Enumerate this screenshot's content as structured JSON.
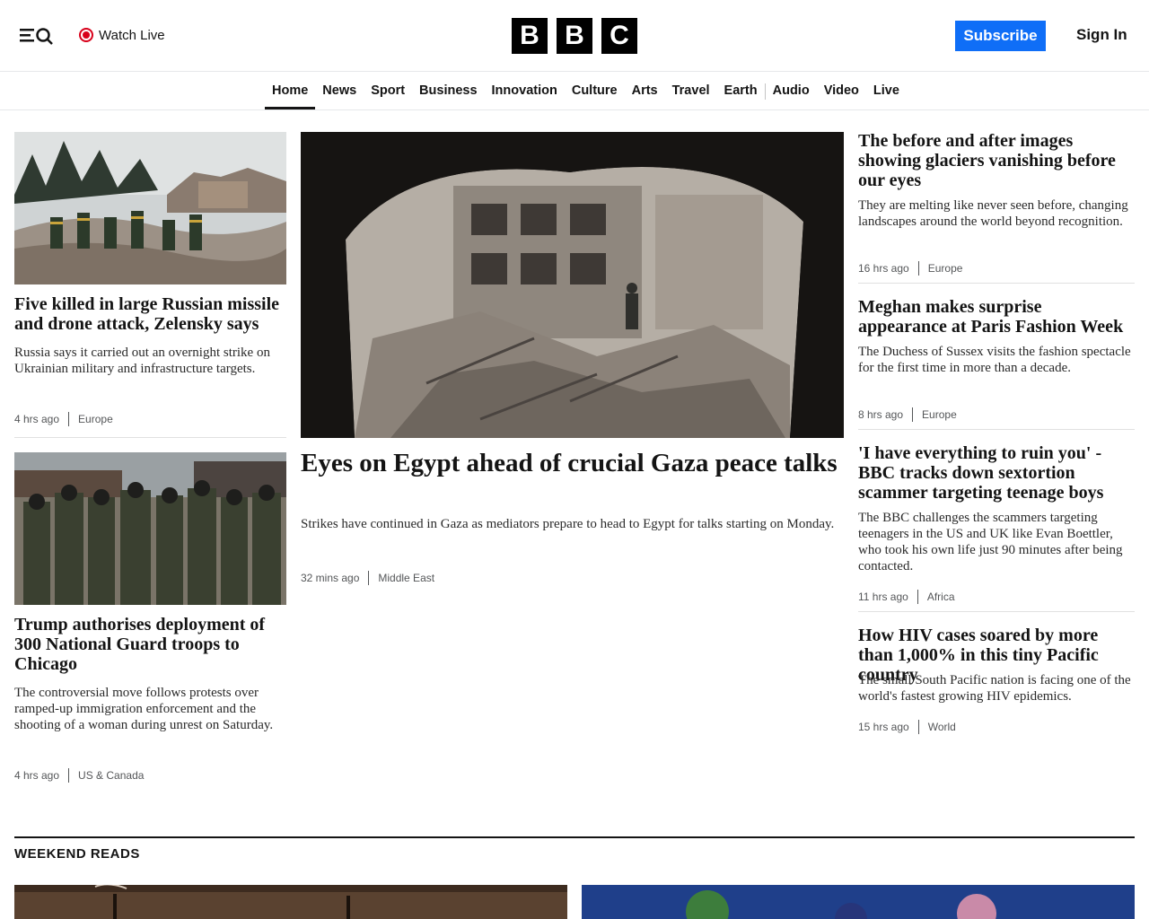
{
  "header": {
    "watch_live_label": "Watch Live",
    "logo_letters": [
      "B",
      "B",
      "C"
    ],
    "subscribe_label": "Subscribe",
    "signin_label": "Sign In"
  },
  "nav": {
    "items": [
      "Home",
      "News",
      "Sport",
      "Business",
      "Innovation",
      "Culture",
      "Arts",
      "Travel",
      "Earth",
      "Audio",
      "Video",
      "Live"
    ],
    "active": "Home"
  },
  "articles": {
    "left1": {
      "headline": "Five killed in large Russian missile and drone attack, Zelensky says",
      "summary": "Russia says it carried out an overnight strike on Ukrainian military and infrastructure targets.",
      "time": "4 hrs ago",
      "category": "Europe"
    },
    "left2": {
      "headline": "Trump authorises deployment of 300 National Guard troops to Chicago",
      "summary": "The controversial move follows protests over ramped-up immigration enforcement and the shooting of a woman during unrest on Saturday.",
      "time": "4 hrs ago",
      "category": "US & Canada"
    },
    "main": {
      "headline": "Eyes on Egypt ahead of crucial Gaza peace talks",
      "summary": "Strikes have continued in Gaza as mediators prepare to head to Egypt for talks starting on Monday.",
      "time": "32 mins ago",
      "category": "Middle East"
    },
    "right1": {
      "headline": "The before and after images showing glaciers vanishing before our eyes",
      "summary": "They are melting like never seen before, changing landscapes around the world beyond recognition.",
      "time": "16 hrs ago",
      "category": "Europe"
    },
    "right2": {
      "headline": "Meghan makes surprise appearance at Paris Fashion Week",
      "summary": "The Duchess of Sussex visits the fashion spectacle for the first time in more than a decade.",
      "time": "8 hrs ago",
      "category": "Europe"
    },
    "right3": {
      "headline": "'I have everything to ruin you' - BBC tracks down sextortion scammer targeting teenage boys",
      "summary": "The BBC challenges the scammers targeting teenagers in the US and UK like Evan Boettler, who took his own life just 90 minutes after being contacted.",
      "time": "11 hrs ago",
      "category": "Africa"
    },
    "right4": {
      "headline": "How HIV cases soared by more than 1,000% in this tiny Pacific country",
      "summary": "The small South Pacific nation is facing one of the world's fastest growing HIV epidemics.",
      "time": "15 hrs ago",
      "category": "World"
    }
  },
  "sections": {
    "weekend_reads_title": "WEEKEND READS"
  }
}
